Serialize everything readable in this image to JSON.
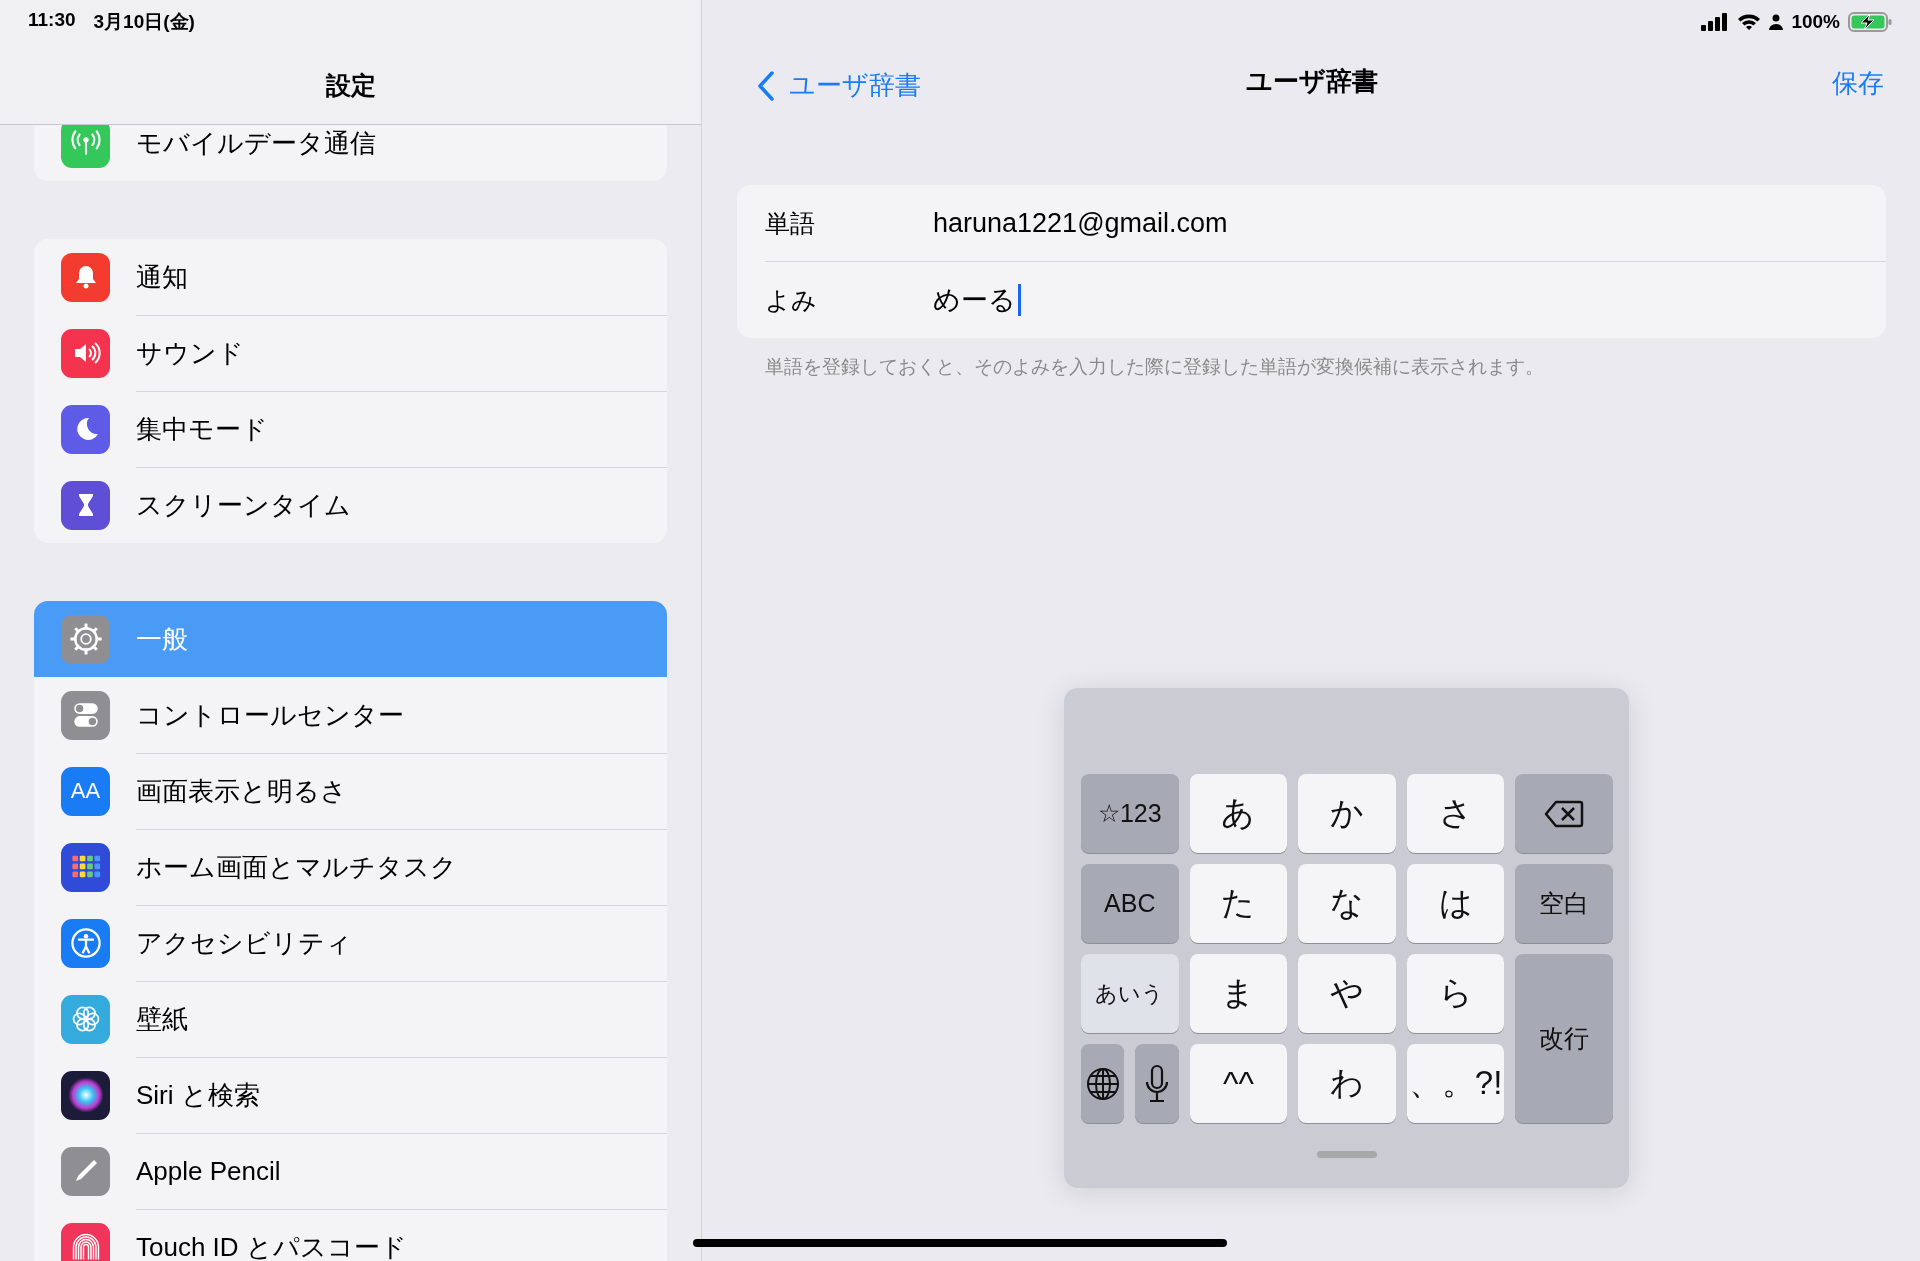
{
  "status_bar": {
    "time": "11:30",
    "date": "3月10日(金)",
    "battery": "100%"
  },
  "sidebar": {
    "title": "設定",
    "groups": [
      {
        "items": [
          {
            "label": "モバイルデータ通信",
            "color": "#34c759",
            "selected": false
          }
        ]
      },
      {
        "items": [
          {
            "label": "通知",
            "color": "#f43b30",
            "selected": false
          },
          {
            "label": "サウンド",
            "color": "#f4344f",
            "selected": false
          },
          {
            "label": "集中モード",
            "color": "#5e5ce6",
            "selected": false
          },
          {
            "label": "スクリーンタイム",
            "color": "#5e4fd6",
            "selected": false
          }
        ]
      },
      {
        "items": [
          {
            "label": "一般",
            "color": "#8e8e93",
            "selected": true
          },
          {
            "label": "コントロールセンター",
            "color": "#8e8e93",
            "selected": false
          },
          {
            "label": "画面表示と明るさ",
            "glyph": "AA",
            "color": "#1a7cf5",
            "selected": false
          },
          {
            "label": "ホーム画面とマルチタスク",
            "color": "#2f4bd8",
            "selected": false
          },
          {
            "label": "アクセシビリティ",
            "color": "#1a7cf5",
            "selected": false
          },
          {
            "label": "壁紙",
            "color": "#35aadc",
            "selected": false
          },
          {
            "label": "Siri と検索",
            "color": "#1c1c3a",
            "selected": false
          },
          {
            "label": "Apple Pencil",
            "color": "#8e8e93",
            "selected": false
          },
          {
            "label": "Touch ID とパスコード",
            "color": "#f1345a",
            "selected": false
          }
        ]
      }
    ]
  },
  "detail": {
    "back": "ユーザ辞書",
    "title": "ユーザ辞書",
    "save": "保存",
    "fields": [
      {
        "label": "単語",
        "value": "haruna1221@gmail.com",
        "focused": false
      },
      {
        "label": "よみ",
        "value": "めーる",
        "focused": true
      }
    ],
    "footnote": "単語を登録しておくと、そのよみを入力した際に登録した単語が変換候補に表示されます。"
  },
  "keyboard": {
    "keys": [
      {
        "kind": "function",
        "label": "☆123"
      },
      {
        "kind": "char",
        "label": "あ"
      },
      {
        "kind": "char",
        "label": "か"
      },
      {
        "kind": "char",
        "label": "さ"
      },
      {
        "kind": "delete"
      },
      {
        "kind": "function",
        "label": "ABC"
      },
      {
        "kind": "char",
        "label": "た"
      },
      {
        "kind": "char",
        "label": "な"
      },
      {
        "kind": "char",
        "label": "は"
      },
      {
        "kind": "function",
        "label": "空白"
      },
      {
        "kind": "mode",
        "label": "あいう"
      },
      {
        "kind": "char",
        "label": "ま"
      },
      {
        "kind": "char",
        "label": "や"
      },
      {
        "kind": "char",
        "label": "ら"
      },
      {
        "kind": "return",
        "label": "改行"
      },
      {
        "kind": "globe"
      },
      {
        "kind": "mic"
      },
      {
        "kind": "char",
        "label": "^^"
      },
      {
        "kind": "char",
        "label": "わ"
      },
      {
        "kind": "char",
        "label": "、。?!"
      }
    ]
  }
}
